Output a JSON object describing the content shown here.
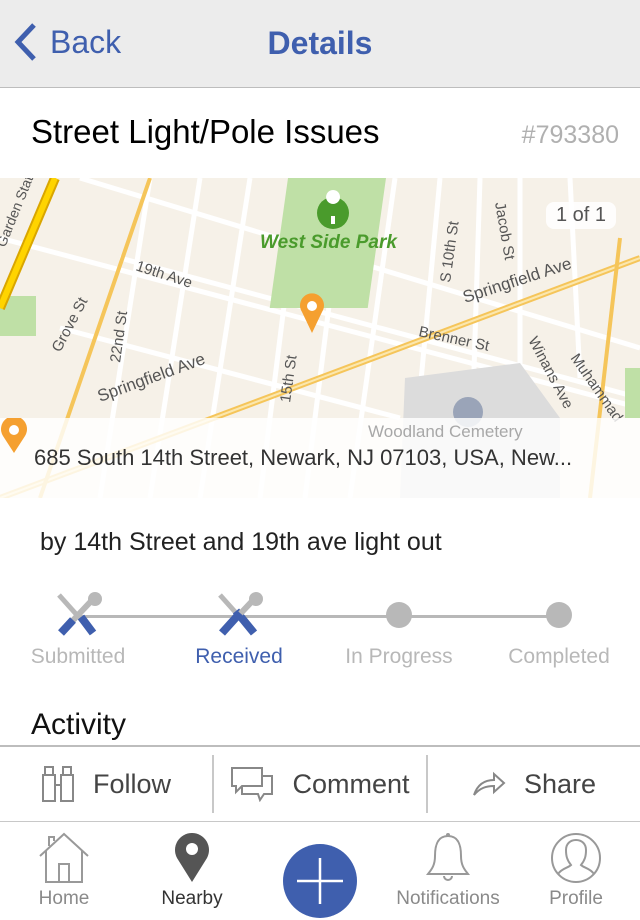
{
  "nav": {
    "back_label": "Back",
    "title": "Details"
  },
  "issue": {
    "title": "Street Light/Pole Issues",
    "ticket": "#793380",
    "description": "by 14th Street and 19th ave light out"
  },
  "map": {
    "badge": "1 of 1",
    "address": "685 South 14th Street, Newark, NJ 07103, USA, New...",
    "labels": {
      "park": "West Side Park",
      "springfield1": "Springfield Ave",
      "springfield2": "Springfield Ave",
      "grove": "Grove St",
      "nineteenth": "19th Ave",
      "twentysecond": "22nd St",
      "fifteenth": "15th St",
      "tenth": "S 10th St",
      "jacob": "Jacob St",
      "brenner": "Brenner St",
      "winans": "Winans Ave",
      "muhammad": "Muhammad",
      "cemetery": "Woodland Cemetery",
      "pkwy": "Garden State Pkwy"
    },
    "pin_color": "#f5a030",
    "park_color": "#bfe0a6"
  },
  "progress": {
    "steps": [
      {
        "label": "Submitted",
        "status": "done"
      },
      {
        "label": "Received",
        "status": "current"
      },
      {
        "label": "In Progress",
        "status": "pending"
      },
      {
        "label": "Completed",
        "status": "pending"
      }
    ]
  },
  "activity": {
    "heading": "Activity"
  },
  "actions": {
    "follow": "Follow",
    "comment": "Comment",
    "share": "Share"
  },
  "tabs": {
    "home": "Home",
    "nearby": "Nearby",
    "notifications": "Notifications",
    "profile": "Profile",
    "selected": "Nearby"
  },
  "colors": {
    "accent": "#3f5fae"
  }
}
